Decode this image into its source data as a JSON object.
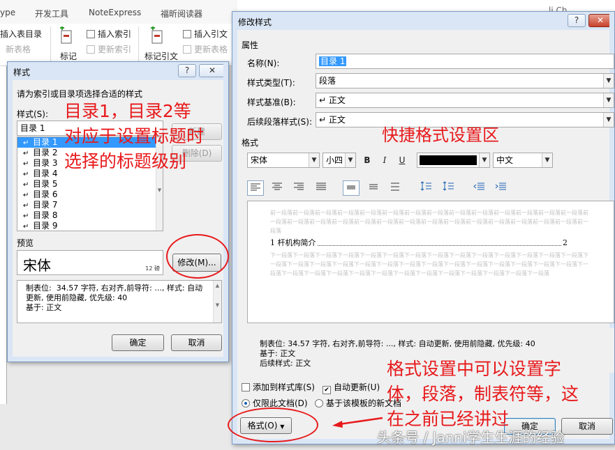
{
  "ribbon": {
    "tabs": [
      "ype",
      "开发工具",
      "NoteExpress",
      "福昕阅读器"
    ],
    "group1": {
      "insert_toc": "插入表目录",
      "update_table": "新表格"
    },
    "group2": {
      "mark_label": "标记",
      "insert_index": "插入索引",
      "update_index": "更新索引"
    },
    "group3": {
      "mark_citation_label": "标记引文",
      "insert_citation_table": "插入引文",
      "update_citation_table": "更新表格"
    },
    "right_label": "li Ch"
  },
  "style_dialog": {
    "title": "样式",
    "help": "?",
    "close": "✕",
    "instruction": "请为索引或目录项选择合适的样式",
    "styles_label": "样式(S):",
    "current_style": "目录 1",
    "items": [
      "目录 1",
      "目录 2",
      "目录 3",
      "目录 4",
      "目录 5",
      "目录 6",
      "目录 7",
      "目录 8",
      "目录 9"
    ],
    "selected_index": 0,
    "new_button": "新建",
    "delete_button": "删除(D)",
    "preview_label": "预览",
    "preview_font": "宋体",
    "preview_size": "12 磅",
    "modify_button": "修改(M)...",
    "description": "制表位:  34.57 字符, 右对齐,前导符: ..., 样式: 自动更新, 使用前隐藏, 优先级: 40\n基于: 正文",
    "ok": "确定",
    "cancel": "取消"
  },
  "modify_dialog": {
    "title": "修改样式",
    "help": "?",
    "close": "✕",
    "properties_label": "属性",
    "name_label": "名称(N):",
    "name_value": "目录 1",
    "type_label": "样式类型(T):",
    "type_value": "段落",
    "based_on_label": "样式基准(B):",
    "based_on_value": "↵ 正文",
    "next_label": "后续段落样式(S):",
    "next_value": "↵ 正文",
    "format_label": "格式",
    "font_value": "宋体",
    "size_value": "小四",
    "bold": "B",
    "italic": "I",
    "underline": "U",
    "font_color": "#000000",
    "lang_value": "中文",
    "ghost_prev": "前一段落前一段落前一段落前一段落前一段落前一段落前一段落前一段落前一段落前一段落前一段落前一段落前一段落前一段落前一段落前一段落前一段落前一段落前一段落前一段落前一段落前一段落前一段落前一段落前一段落前一段落前一段落前一段落前一段落",
    "sample_text": "1 杆机构简介",
    "sample_page": "2",
    "ghost_next": "下一段落下一段落下一段落下一段落下一段落下一段落下一段落下一段落下一段落下一段落下一段落下一段落下一段落下一段落下一段落下一段落下一段落下一段落下一段落下一段落下一段落下一段落下一段落下一段落下一段落下一段落下一段落下一段落下一段落下一段落下一段落下一段落下一段落下一段落下一段落下一段落下一段落下一段落下一段落下一段落下一段落",
    "detail_line1": "制表位:  34.57 字符, 右对齐,前导符: ..., 样式: 自动更新, 使用前隐藏, 优先级: 40",
    "detail_line2": "基于: 正文",
    "detail_line3": "后续样式: 正文",
    "add_to_gallery": "添加到样式库(S)",
    "auto_update": "自动更新(U)",
    "only_this_doc": "仅限此文档(D)",
    "template_docs": "基于该模板的新文档",
    "format_button": "格式(O)",
    "ok": "确定",
    "cancel": "取消"
  },
  "annotations": {
    "left_note_1": "目录1，目录2等",
    "left_note_2": "对应于设置标题时",
    "left_note_3": "选择的标题级别",
    "quick_format": "快捷格式设置区",
    "bottom_note_1": "格式设置中可以设置字",
    "bottom_note_2": "体，段落，制表符等，这",
    "bottom_note_3": "在之前已经讲过",
    "color": "#e8191b"
  },
  "watermark": "头条号 / Janni学生生涯的经验"
}
